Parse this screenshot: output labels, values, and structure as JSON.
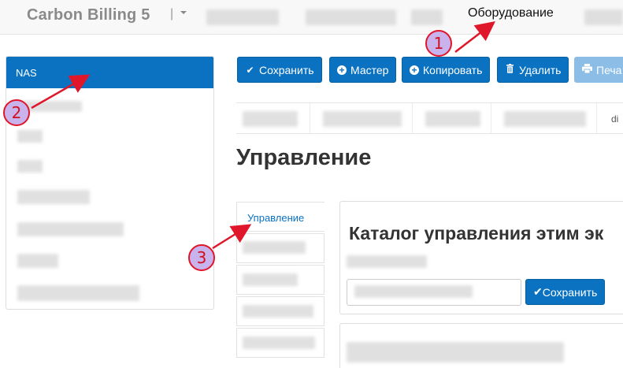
{
  "navbar": {
    "brand": "Carbon Billing 5",
    "separator": "|",
    "active_item": "Оборудование"
  },
  "sidebar": {
    "active_item": "NAS"
  },
  "toolbar": {
    "save": "Сохранить",
    "wizard": "Мастер",
    "copy": "Копировать",
    "delete": "Удалить",
    "print": "Печа"
  },
  "tabs": {
    "cut_label": "di"
  },
  "main": {
    "heading": "Управление",
    "vertical_tab_active": "Управление",
    "panel_title": "Каталог управления этим эк",
    "save_button": "Сохранить"
  },
  "annotations": [
    "1",
    "2",
    "3"
  ],
  "colors": {
    "primary": "#0a72c1",
    "annotation_fill": "#c9b3ec",
    "annotation_stroke": "#e0162b"
  }
}
